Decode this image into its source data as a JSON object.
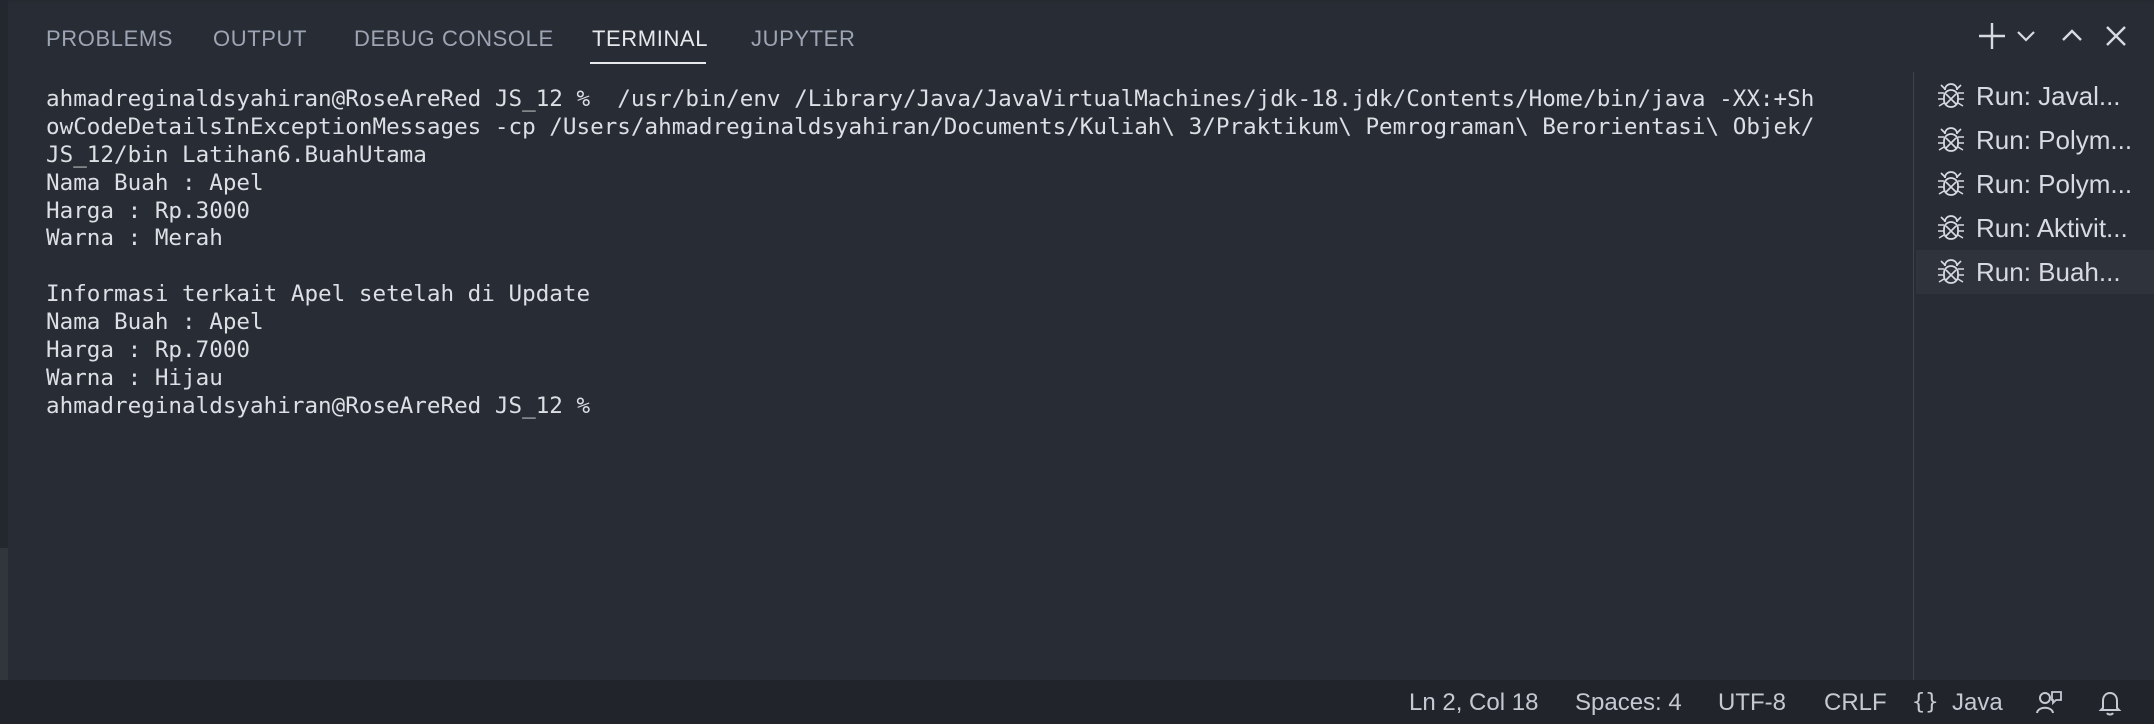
{
  "panel": {
    "tabs": [
      {
        "label": "PROBLEMS"
      },
      {
        "label": "OUTPUT"
      },
      {
        "label": "DEBUG CONSOLE"
      },
      {
        "label": "TERMINAL",
        "active": true
      },
      {
        "label": "JUPYTER"
      }
    ],
    "actions": [
      "plus-icon",
      "chevron-down-icon",
      "chevron-up-icon",
      "close-icon"
    ]
  },
  "terminal": {
    "lines": [
      "ahmadreginaldsyahiran@RoseAreRed JS_12 %  /usr/bin/env /Library/Java/JavaVirtualMachines/jdk-18.jdk/Contents/Home/bin/java -XX:+Sh",
      "owCodeDetailsInExceptionMessages -cp /Users/ahmadreginaldsyahiran/Documents/Kuliah\\ 3/Praktikum\\ Pemrograman\\ Berorientasi\\ Objek/",
      "JS_12/bin Latihan6.BuahUtama",
      "Nama Buah : Apel",
      "Harga : Rp.3000",
      "Warna : Merah",
      "",
      "Informasi terkait Apel setelah di Update",
      "Nama Buah : Apel",
      "Harga : Rp.7000",
      "Warna : Hijau",
      "ahmadreginaldsyahiran@RoseAreRed JS_12 %"
    ]
  },
  "terminals_list": [
    {
      "label": "Run: Javal...",
      "icon": "bug-icon"
    },
    {
      "label": "Run: Polym...",
      "icon": "bug-icon"
    },
    {
      "label": "Run: Polym...",
      "icon": "bug-icon"
    },
    {
      "label": "Run: Aktivit...",
      "icon": "bug-icon"
    },
    {
      "label": "Run: Buah...",
      "icon": "bug-icon",
      "active": true
    }
  ],
  "statusbar": {
    "position": "Ln 2, Col 18",
    "spaces": "Spaces: 4",
    "encoding": "UTF-8",
    "eol": "CRLF",
    "language_glyph": "{}",
    "language": "Java",
    "icons": [
      "feedback-icon",
      "bell-icon"
    ]
  },
  "colors": {
    "background": "#282c34",
    "statusbar": "#21252b",
    "active_tab": "#e6e8ec",
    "inactive_tab": "#9da5b4"
  }
}
